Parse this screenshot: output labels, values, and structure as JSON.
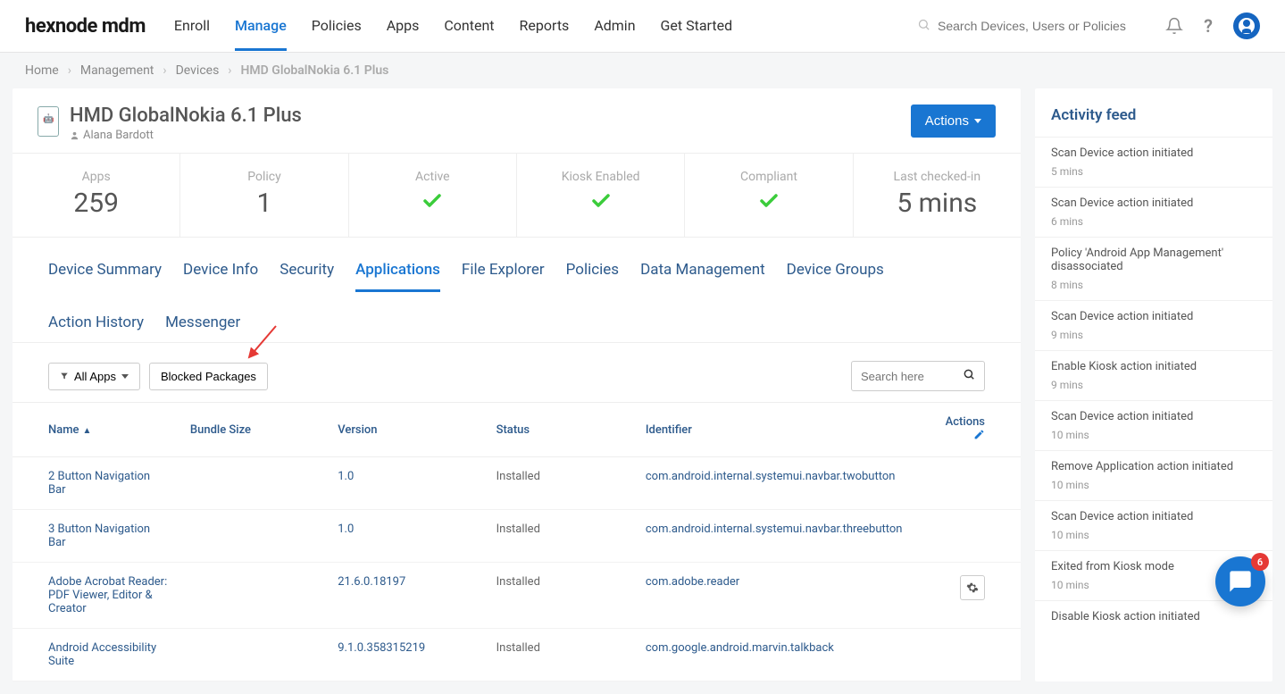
{
  "brand": "hexnode mdm",
  "nav": [
    "Enroll",
    "Manage",
    "Policies",
    "Apps",
    "Content",
    "Reports",
    "Admin",
    "Get Started"
  ],
  "nav_active": 1,
  "search": {
    "placeholder": "Search Devices, Users or Policies",
    "magnifier": "🔍"
  },
  "breadcrumb": {
    "items": [
      "Home",
      "Management",
      "Devices"
    ],
    "current": "HMD GlobalNokia 6.1 Plus"
  },
  "device": {
    "title": "HMD GlobalNokia 6.1 Plus",
    "owner": "Alana Bardott",
    "actions_label": "Actions"
  },
  "stats": [
    {
      "label": "Apps",
      "value": "259",
      "type": "num"
    },
    {
      "label": "Policy",
      "value": "1",
      "type": "num"
    },
    {
      "label": "Active",
      "type": "check"
    },
    {
      "label": "Kiosk Enabled",
      "type": "check"
    },
    {
      "label": "Compliant",
      "type": "check"
    },
    {
      "label": "Last checked-in",
      "value": "5 mins",
      "type": "num"
    }
  ],
  "tabs": [
    "Device Summary",
    "Device Info",
    "Security",
    "Applications",
    "File Explorer",
    "Policies",
    "Data Management",
    "Device Groups",
    "Action History",
    "Messenger"
  ],
  "tabs_active": 3,
  "filters": {
    "all_apps": "All Apps",
    "blocked": "Blocked Packages",
    "search_placeholder": "Search here"
  },
  "table": {
    "headers": {
      "name": "Name",
      "bundle": "Bundle Size",
      "version": "Version",
      "status": "Status",
      "identifier": "Identifier",
      "actions": "Actions"
    },
    "rows": [
      {
        "name": "2 Button Navigation Bar",
        "bundle": "",
        "version": "1.0",
        "status": "Installed",
        "identifier": "com.android.internal.systemui.navbar.twobutton",
        "gear": false
      },
      {
        "name": "3 Button Navigation Bar",
        "bundle": "",
        "version": "1.0",
        "status": "Installed",
        "identifier": "com.android.internal.systemui.navbar.threebutton",
        "gear": false
      },
      {
        "name": "Adobe Acrobat Reader: PDF Viewer, Editor & Creator",
        "bundle": "",
        "version": "21.6.0.18197",
        "status": "Installed",
        "identifier": "com.adobe.reader",
        "gear": true
      },
      {
        "name": "Android Accessibility Suite",
        "bundle": "",
        "version": "9.1.0.358315219",
        "status": "Installed",
        "identifier": "com.google.android.marvin.talkback",
        "gear": false
      }
    ]
  },
  "feed": {
    "title": "Activity feed",
    "items": [
      {
        "text": "Scan Device action initiated",
        "time": "5 mins"
      },
      {
        "text": "Scan Device action initiated",
        "time": "6 mins"
      },
      {
        "text": "Policy 'Android App Management' disassociated",
        "time": "8 mins"
      },
      {
        "text": "Scan Device action initiated",
        "time": "9 mins"
      },
      {
        "text": "Enable Kiosk action initiated",
        "time": "9 mins"
      },
      {
        "text": "Scan Device action initiated",
        "time": "10 mins"
      },
      {
        "text": "Remove Application action initiated",
        "time": "10 mins"
      },
      {
        "text": "Scan Device action initiated",
        "time": "10 mins"
      },
      {
        "text": "Exited from Kiosk mode",
        "time": "10 mins"
      },
      {
        "text": "Disable Kiosk action initiated",
        "time": ""
      }
    ]
  },
  "chat": {
    "badge": "6"
  }
}
